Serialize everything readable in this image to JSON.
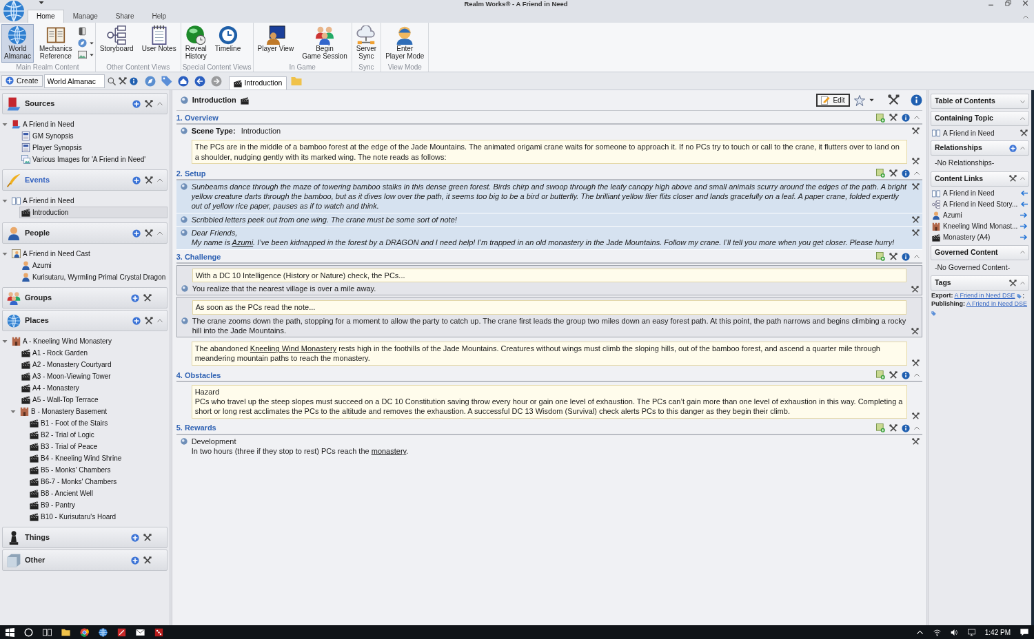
{
  "window": {
    "title": "Realm Works® - A Friend in Need"
  },
  "ribbon": {
    "tabs": [
      {
        "label": "Home",
        "selected": true
      },
      {
        "label": "Manage",
        "selected": false
      },
      {
        "label": "Share",
        "selected": false
      },
      {
        "label": "Help",
        "selected": false
      }
    ],
    "groups": [
      {
        "label": "Main Realm Content",
        "buttons": [
          {
            "lines": [
              "World",
              "Almanac"
            ],
            "kind": "globe",
            "selected": true
          },
          {
            "lines": [
              "Mechanics",
              "Reference"
            ],
            "kind": "ledger",
            "selected": false
          }
        ],
        "small_buttons": [
          {
            "dropdown": false
          },
          {
            "dropdown": true
          },
          {
            "dropdown": true
          }
        ]
      },
      {
        "label": "Other Content Views",
        "buttons": [
          {
            "lines": [
              "Storyboard"
            ],
            "kind": "storyboard",
            "selected": false
          },
          {
            "lines": [
              "User Notes"
            ],
            "kind": "notepad",
            "selected": false
          }
        ]
      },
      {
        "label": "Special Content Views",
        "buttons": [
          {
            "lines": [
              "Reveal",
              "History"
            ],
            "kind": "orb",
            "selected": false
          },
          {
            "lines": [
              "Timeline"
            ],
            "kind": "clock",
            "selected": false
          }
        ]
      },
      {
        "label": "In Game",
        "buttons": [
          {
            "lines": [
              "Player View"
            ],
            "kind": "monitor",
            "selected": false
          },
          {
            "lines": [
              "Begin",
              "Game Session"
            ],
            "kind": "people",
            "selected": false
          }
        ]
      },
      {
        "label": "Sync",
        "buttons": [
          {
            "lines": [
              "Server",
              "Sync"
            ],
            "kind": "cloud",
            "selected": false
          }
        ]
      },
      {
        "label": "View Mode",
        "buttons": [
          {
            "lines": [
              "Enter",
              "Player Mode"
            ],
            "kind": "helmet",
            "selected": false
          }
        ]
      }
    ]
  },
  "toolbar": {
    "create": "Create",
    "search": "World Almanac",
    "nav": [
      {
        "kind": "compass",
        "disabled": false
      },
      {
        "kind": "tag",
        "disabled": false
      },
      {
        "kind": "home",
        "disabled": false
      },
      {
        "kind": "back",
        "disabled": false
      },
      {
        "kind": "forward",
        "disabled": true
      }
    ],
    "tabs": [
      {
        "label": "Introduction",
        "selected": true
      }
    ]
  },
  "sidebar": [
    {
      "title": "Sources",
      "kind": "book-red",
      "selected": false,
      "expanded": true,
      "items": [
        {
          "label": "A Friend in Need",
          "kind": "book-red",
          "selected": false,
          "expanded": true,
          "children": [
            {
              "label": "GM Synopsis",
              "kind": "doc",
              "selected": false
            },
            {
              "label": "Player Synopsis",
              "kind": "doc",
              "selected": false
            },
            {
              "label": "Various Images for 'A Friend in Need'",
              "kind": "images",
              "selected": false
            }
          ]
        }
      ]
    },
    {
      "title": "Events",
      "kind": "quill",
      "selected": true,
      "expanded": true,
      "items": [
        {
          "label": "A Friend in Need",
          "kind": "book-open",
          "selected": false,
          "expanded": true,
          "children": [
            {
              "label": "Introduction",
              "kind": "clapper",
              "selected": true
            }
          ]
        }
      ]
    },
    {
      "title": "People",
      "kind": "person",
      "selected": false,
      "expanded": true,
      "items": [
        {
          "label": "A Friend in Need Cast",
          "kind": "cast",
          "selected": false,
          "expanded": true,
          "children": [
            {
              "label": "Azumi",
              "kind": "person",
              "selected": false
            },
            {
              "label": "Kurisutaru, Wyrmling Primal Crystal Dragon",
              "kind": "person",
              "selected": false
            }
          ]
        }
      ]
    },
    {
      "title": "Groups",
      "kind": "people",
      "selected": false,
      "expanded": false
    },
    {
      "title": "Places",
      "kind": "globe",
      "selected": false,
      "expanded": true,
      "items": [
        {
          "label": "A - Kneeling Wind Monastery",
          "kind": "castle",
          "selected": false,
          "expanded": true,
          "children": [
            {
              "label": "A1 - Rock Garden",
              "kind": "clapper",
              "selected": false
            },
            {
              "label": "A2 - Monastery Courtyard",
              "kind": "clapper",
              "selected": false
            },
            {
              "label": "A3 - Moon-Viewing Tower",
              "kind": "clapper",
              "selected": false
            },
            {
              "label": "A4 - Monastery",
              "kind": "clapper",
              "selected": false
            },
            {
              "label": "A5 - Wall-Top Terrace",
              "kind": "clapper",
              "selected": false
            },
            {
              "label": "B - Monastery Basement",
              "kind": "castle",
              "selected": false,
              "expanded": true,
              "children": [
                {
                  "label": "B1 - Foot of the Stairs",
                  "kind": "clapper",
                  "selected": false
                },
                {
                  "label": "B2 - Trial of Logic",
                  "kind": "clapper",
                  "selected": false
                },
                {
                  "label": "B3 - Trial of Peace",
                  "kind": "clapper",
                  "selected": false
                },
                {
                  "label": "B4 - Kneeling Wind Shrine",
                  "kind": "clapper",
                  "selected": false
                },
                {
                  "label": "B5 - Monks' Chambers",
                  "kind": "clapper",
                  "selected": false
                },
                {
                  "label": "B6-7 - Monks' Chambers",
                  "kind": "clapper",
                  "selected": false
                },
                {
                  "label": "B8 - Ancient Well",
                  "kind": "clapper",
                  "selected": false
                },
                {
                  "label": "B9 - Pantry",
                  "kind": "clapper",
                  "selected": false
                },
                {
                  "label": "B10 - Kurisutaru's Hoard",
                  "kind": "clapper",
                  "selected": false
                }
              ]
            }
          ]
        }
      ]
    },
    {
      "title": "Things",
      "kind": "pawn",
      "selected": false,
      "expanded": false
    },
    {
      "title": "Other",
      "kind": "cube",
      "selected": false,
      "expanded": false
    }
  ],
  "page": {
    "title": "Introduction",
    "edit": "Edit",
    "sections": [
      {
        "title": "1. Overview",
        "expanded": true,
        "snippets": [
          {
            "kind": "field",
            "label": "Scene Type:",
            "value": "Introduction"
          },
          {
            "kind": "note",
            "box": [
              "The PCs are in the middle of a bamboo forest at the edge of the Jade Mountains. The animated origami crane waits for someone to approach it. If no PCs try to touch or call to the crane, it flutters over to land on a shoulder, nudging gently with its marked wing. The note reads as follows:"
            ]
          }
        ]
      },
      {
        "title": "2. Setup",
        "expanded": true,
        "snippets": [
          {
            "kind": "read-aloud",
            "text": [
              "Sunbeams dance through the maze of towering bamboo stalks in this dense green forest. Birds chirp and swoop through the leafy canopy high above and small animals scurry around the edges of the path. A bright yellow creature darts through the bamboo, but as it dives low over the path, it seems too big to be a bird or butterfly. The brilliant yellow flier flits closer and lands gracefully on a leaf. A paper crane, folded expertly out of yellow rice paper, pauses as if to watch and think."
            ]
          },
          {
            "kind": "read-aloud",
            "text": [
              "Scribbled letters peek out from one wing. The crane must be some sort of note!"
            ]
          },
          {
            "kind": "read-aloud",
            "text": [
              "Dear Friends,",
              [
                {
                  "text": "My name is "
                },
                {
                  "link": "Azumi"
                },
                {
                  "text": ". I’ve been kidnapped in the forest by a DRAGON and I need help! I’m trapped in an old monastery in the Jade Mountains. Follow my crane. I’ll tell you more when you get closer. Please hurry!"
                }
              ]
            ]
          }
        ]
      },
      {
        "title": "3. Challenge",
        "expanded": true,
        "snippets": [
          {
            "kind": "check",
            "box": [
              "With a DC 10 Intelligence (History or Nature) check, the PCs..."
            ],
            "text": [
              "You realize that the nearest village is over a mile away."
            ]
          },
          {
            "kind": "check",
            "box": [
              "As soon as the PCs read the note..."
            ],
            "text": [
              "The crane zooms down the path, stopping for a moment to allow the party to catch up. The crane first leads the group two miles down an easy forest path. At this point, the path narrows and begins climbing a rocky hill into the Jade Mountains."
            ]
          },
          {
            "kind": "note",
            "box": [
              [
                {
                  "text": "The abandoned "
                },
                {
                  "link": "Kneeling Wind Monastery"
                },
                {
                  "text": " rests high in the foothills of the Jade Mountains. Creatures without wings must climb the sloping hills, out of the bamboo forest, and ascend a quarter mile through meandering mountain paths to reach the monastery."
                }
              ]
            ]
          }
        ]
      },
      {
        "title": "4. Obstacles",
        "expanded": true,
        "snippets": [
          {
            "kind": "note",
            "box": [
              "Hazard",
              "PCs who travel up the steep slopes must succeed on a DC 10 Constitution saving throw every hour or gain one level of exhaustion. The PCs can’t gain more than one level of exhaustion in this way. Completing a short or long rest acclimates the PCs to the altitude and removes the exhaustion. A successful DC 13 Wisdom (Survival) check alerts PCs to this danger as they begin their climb."
            ]
          }
        ]
      },
      {
        "title": "5. Rewards",
        "expanded": true,
        "snippets": [
          {
            "kind": "gm",
            "text": [
              "Development",
              [
                {
                  "text": "In two hours (three if they stop to rest) PCs reach the "
                },
                {
                  "link": "monastery"
                },
                {
                  "text": "."
                }
              ]
            ]
          }
        ]
      }
    ]
  },
  "details": [
    {
      "title": "Table of Contents",
      "expanded": false
    },
    {
      "title": "Containing Topic",
      "expanded": true,
      "items": [
        {
          "label": "A Friend in Need",
          "kind": "book-open"
        }
      ]
    },
    {
      "title": "Relationships",
      "expanded": true,
      "add": true,
      "empty": "-No Relationships-"
    },
    {
      "title": "Content Links",
      "expanded": true,
      "tools": true,
      "items": [
        {
          "label": "A Friend in Need",
          "kind": "book-open",
          "incoming": true
        },
        {
          "label": "A Friend in Need Story...",
          "kind": "storyboard",
          "incoming": true
        },
        {
          "label": "Azumi",
          "kind": "person",
          "incoming": false
        },
        {
          "label": "Kneeling Wind Monast...",
          "kind": "castle",
          "incoming": false
        },
        {
          "label": "Monastery (A4)",
          "kind": "clapper",
          "incoming": false
        }
      ]
    },
    {
      "title": "Governed Content",
      "expanded": true,
      "empty": "-No Governed Content-"
    },
    {
      "title": "Tags",
      "expanded": true,
      "tools": true,
      "tags": [
        {
          "label": "Export:",
          "value": "A Friend in Need DSE",
          "separator": ";"
        },
        {
          "label": "Publishing:",
          "value": "A Friend in Need DSE"
        }
      ]
    }
  ],
  "taskbar": {
    "time": "1:42 PM"
  }
}
